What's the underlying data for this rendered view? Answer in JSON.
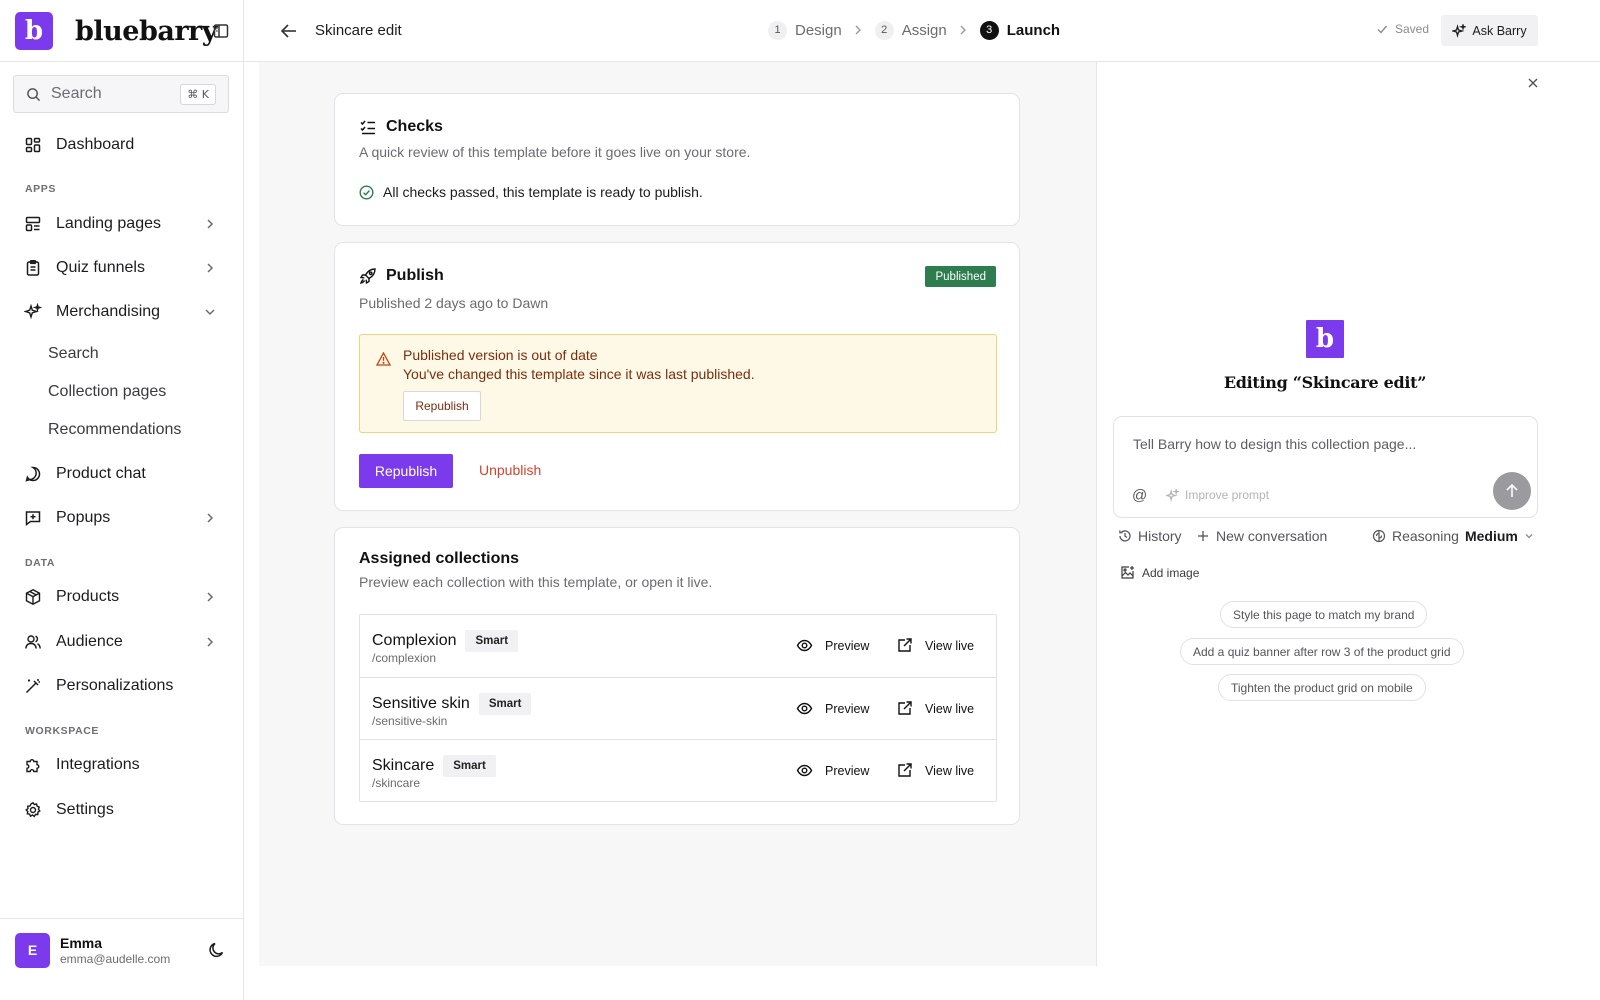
{
  "brand": {
    "logo_letter": "b",
    "name": "bluebarry",
    "accent": "#7c3aed"
  },
  "search": {
    "label": "Search",
    "shortcut": "⌘ K"
  },
  "nav": {
    "dashboard": "Dashboard",
    "section_apps": "APPS",
    "landing_pages": "Landing pages",
    "quiz_funnels": "Quiz funnels",
    "merchandising": "Merchandising",
    "merch_search": "Search",
    "merch_collection_pages": "Collection pages",
    "merch_recommendations": "Recommendations",
    "product_chat": "Product chat",
    "popups": "Popups",
    "section_data": "DATA",
    "products": "Products",
    "audience": "Audience",
    "personalizations": "Personalizations",
    "section_workspace": "WORKSPACE",
    "integrations": "Integrations",
    "settings": "Settings"
  },
  "user": {
    "initial": "E",
    "name": "Emma",
    "email": "emma@audelle.com"
  },
  "header": {
    "title": "Skincare edit",
    "steps": [
      {
        "num": "1",
        "label": "Design"
      },
      {
        "num": "2",
        "label": "Assign"
      },
      {
        "num": "3",
        "label": "Launch"
      }
    ],
    "active_step": 3,
    "saved_label": "Saved",
    "ask_label": "Ask Barry"
  },
  "checks": {
    "title": "Checks",
    "subtitle": "A quick review of this template before it goes live on your store.",
    "status": "All checks passed, this template is ready to publish."
  },
  "publish": {
    "title": "Publish",
    "subtitle": "Published 2 days ago to Dawn",
    "badge": "Published",
    "warning_title": "Published version is out of date",
    "warning_text": "You've changed this template since it was last published.",
    "warning_button": "Republish",
    "primary_button": "Republish",
    "secondary_button": "Unpublish"
  },
  "assigned": {
    "title": "Assigned collections",
    "subtitle": "Preview each collection with this template, or open it live.",
    "preview_label": "Preview",
    "view_live_label": "View live",
    "rows": [
      {
        "name": "Complexion",
        "tag": "Smart",
        "slug": "/complexion"
      },
      {
        "name": "Sensitive skin",
        "tag": "Smart",
        "slug": "/sensitive-skin"
      },
      {
        "name": "Skincare",
        "tag": "Smart",
        "slug": "/skincare"
      }
    ]
  },
  "panel": {
    "logo_letter": "b",
    "heading": "Editing “Skincare edit”",
    "placeholder": "Tell Barry how to design this collection page...",
    "mention": "@",
    "improve": "Improve prompt",
    "history": "History",
    "new_conversation": "New conversation",
    "reasoning_label": "Reasoning",
    "reasoning_value": "Medium",
    "add_image": "Add image",
    "suggestions": [
      "Style this page to match my brand",
      "Add a quiz banner after row 3 of the product grid",
      "Tighten the product grid on mobile"
    ]
  }
}
